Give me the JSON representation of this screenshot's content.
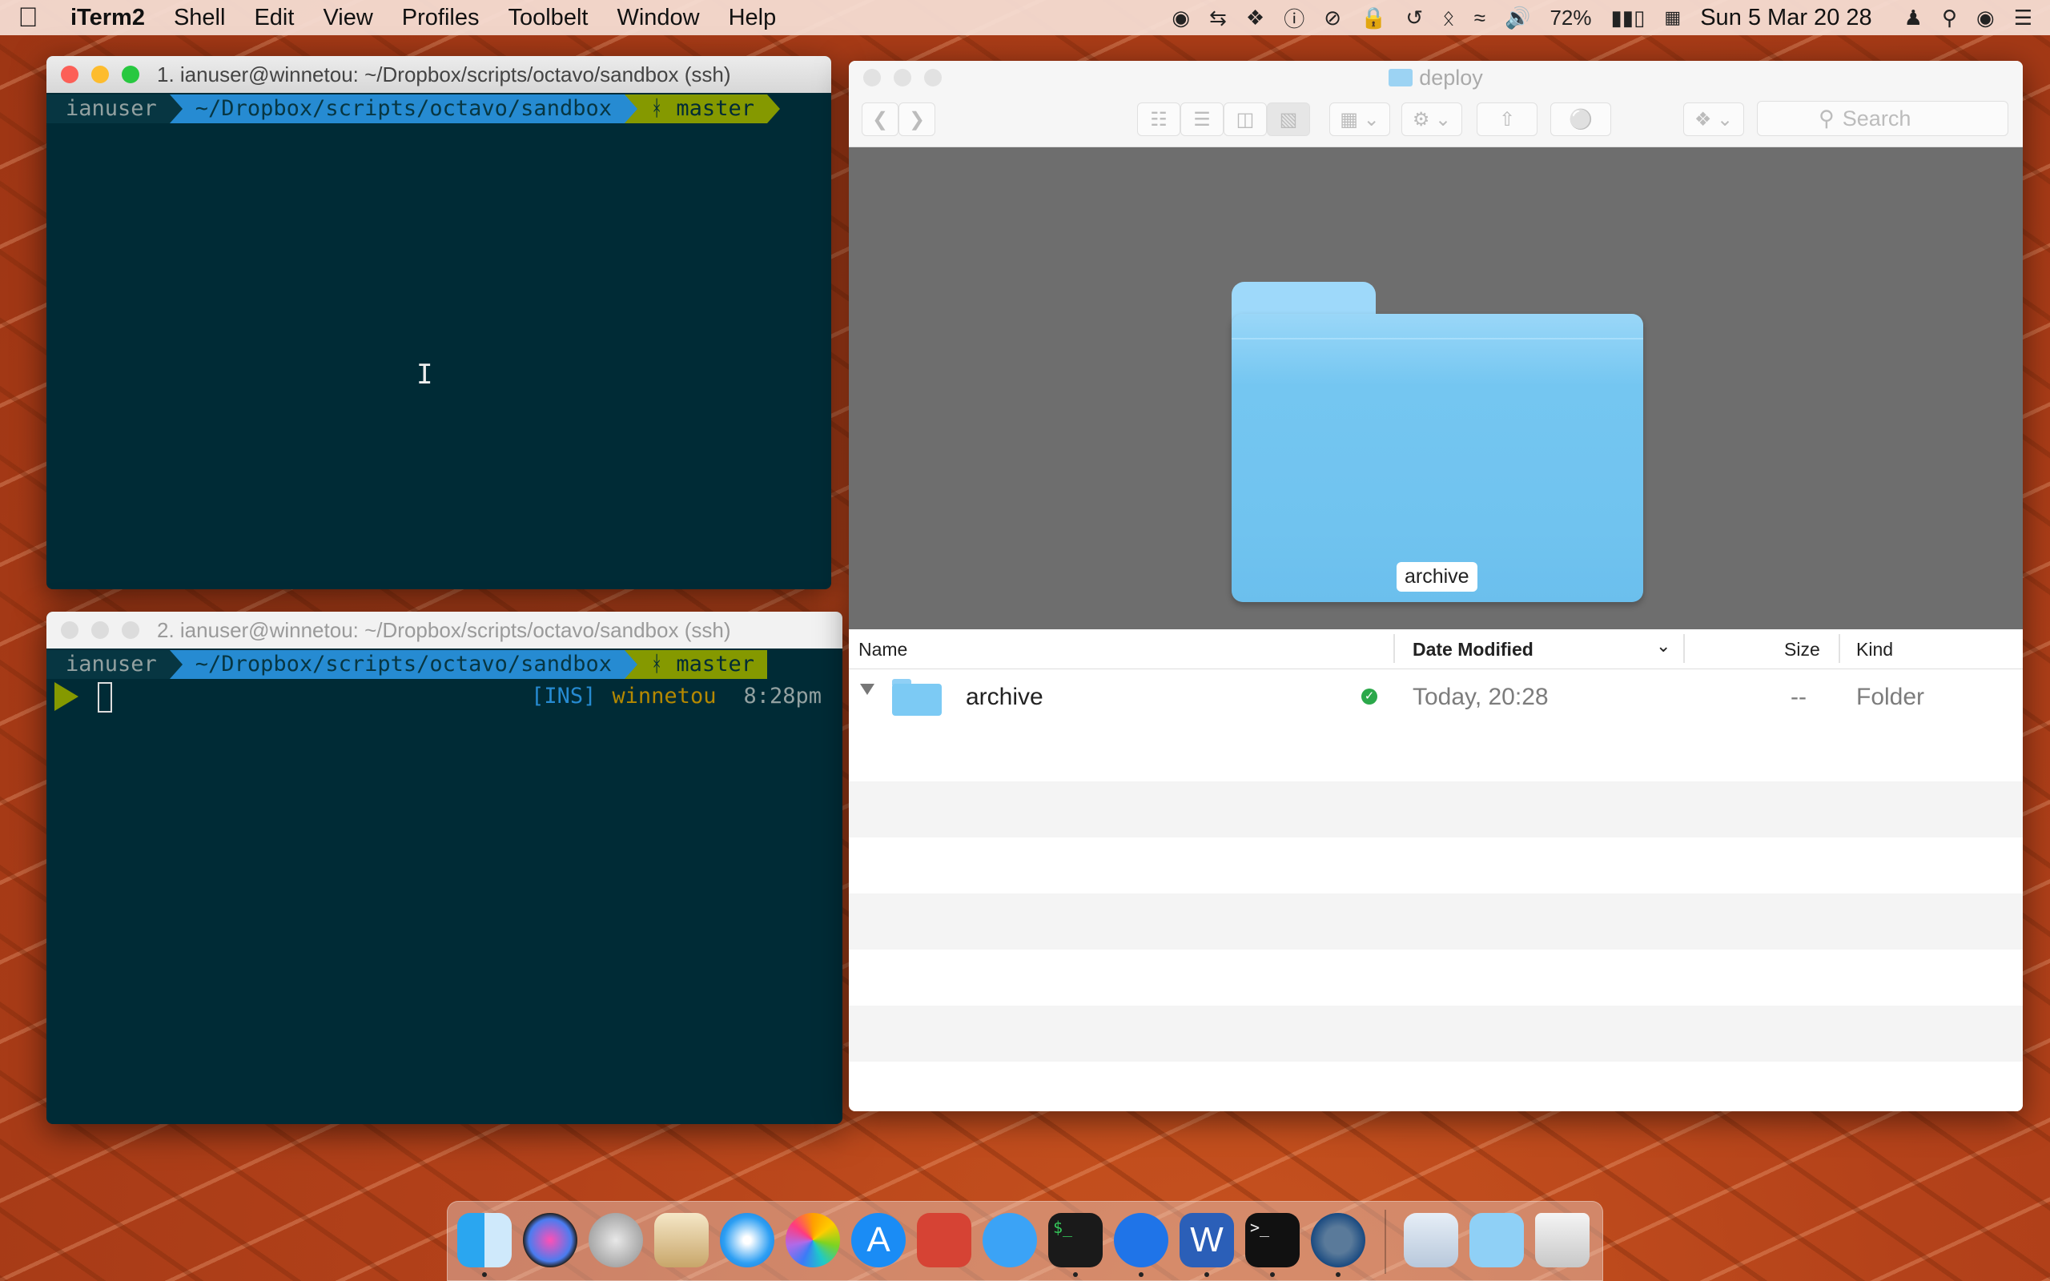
{
  "menubar": {
    "app": "iTerm2",
    "items": [
      "Shell",
      "Edit",
      "View",
      "Profiles",
      "Toolbelt",
      "Window",
      "Help"
    ],
    "battery": "72%",
    "clock": "Sun 5 Mar  20 28"
  },
  "term1": {
    "title": "1. ianuser@winnetou: ~/Dropbox/scripts/octavo/sandbox (ssh)",
    "user": "ianuser",
    "path": "~/Dropbox/scripts/octavo/sandbox",
    "branch": "ᚼ master"
  },
  "term2": {
    "title": "2. ianuser@winnetou: ~/Dropbox/scripts/octavo/sandbox (ssh)",
    "user": "ianuser",
    "path": "~/Dropbox/scripts/octavo/sandbox",
    "branch": "ᚼ master",
    "mode": "[INS]",
    "host": "winnetou",
    "time": "8:28pm"
  },
  "finder": {
    "title": "deploy",
    "search_placeholder": "Search",
    "preview_label": "archive",
    "columns": {
      "name": "Name",
      "date": "Date Modified",
      "size": "Size",
      "kind": "Kind"
    },
    "rows": [
      {
        "name": "archive",
        "date": "Today, 20:28",
        "size": "--",
        "kind": "Folder"
      }
    ]
  },
  "colors": {
    "solarized_base03": "#002b36",
    "powerline_blue": "#268bd2",
    "powerline_green": "#859900",
    "folder_blue": "#7ccaf4"
  },
  "dock": {
    "apps": [
      "finder-icon",
      "siri-icon",
      "launchpad-icon",
      "mail-icon",
      "safari-icon",
      "photos-icon",
      "app-store-icon",
      "remote-desktop-icon",
      "messages-icon",
      "terminal-icon",
      "teamviewer-icon",
      "word-icon",
      "iterm-icon",
      "quicktime-icon",
      "calendar-stack-icon",
      "folder-stack-icon",
      "trash-icon"
    ]
  }
}
